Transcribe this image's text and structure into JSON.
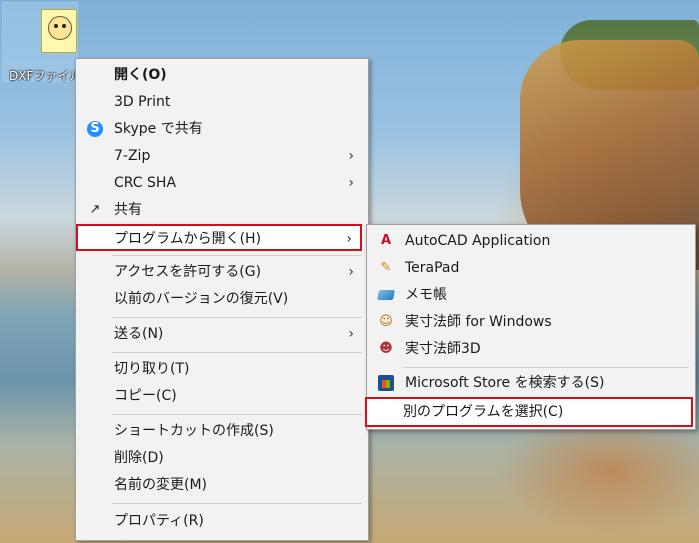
{
  "desktop": {
    "icon_label": "DXFファイル"
  },
  "context_menu": {
    "items": [
      {
        "label": "開く(O)"
      },
      {
        "label": "3D Print"
      },
      {
        "label": "Skype で共有",
        "icon": "skype-icon"
      },
      {
        "label": "7-Zip",
        "has_submenu": true
      },
      {
        "label": "CRC SHA",
        "has_submenu": true
      },
      {
        "label": "共有",
        "icon": "share-icon"
      },
      {
        "label": "プログラムから開く(H)",
        "has_submenu": true,
        "highlighted": true
      },
      {
        "label": "アクセスを許可する(G)",
        "has_submenu": true
      },
      {
        "label": "以前のバージョンの復元(V)"
      },
      {
        "label": "送る(N)",
        "has_submenu": true
      },
      {
        "label": "切り取り(T)"
      },
      {
        "label": "コピー(C)"
      },
      {
        "label": "ショートカットの作成(S)"
      },
      {
        "label": "削除(D)"
      },
      {
        "label": "名前の変更(M)"
      },
      {
        "label": "プロパティ(R)"
      }
    ]
  },
  "open_with_submenu": {
    "items": [
      {
        "label": "AutoCAD Application",
        "icon": "autocad-icon"
      },
      {
        "label": "TeraPad",
        "icon": "terapad-icon"
      },
      {
        "label": "メモ帳",
        "icon": "notepad-icon"
      },
      {
        "label": "実寸法師 for Windows",
        "icon": "jissun-houshi-icon"
      },
      {
        "label": "実寸法師3D",
        "icon": "jissun-houshi-3d-icon"
      },
      {
        "label": "Microsoft Store を検索する(S)",
        "icon": "microsoft-store-icon"
      },
      {
        "label": "別のプログラムを選択(C)",
        "highlighted": true
      }
    ]
  },
  "colors": {
    "highlight_border": "#d0101a",
    "menu_background": "#f2f2f2"
  }
}
